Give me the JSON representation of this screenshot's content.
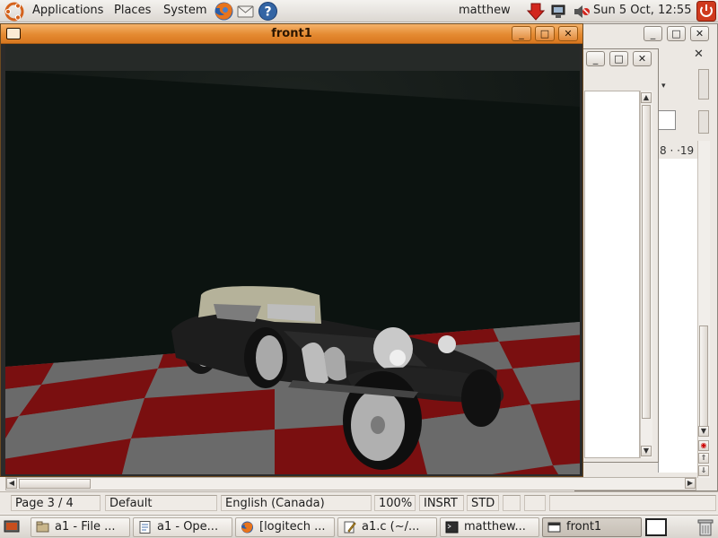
{
  "top_panel": {
    "menus": [
      "Applications",
      "Places",
      "System"
    ],
    "user": "matthew",
    "clock": "Sun  5 Oct, 12:55"
  },
  "window": {
    "title": "front1",
    "buttons": {
      "minimize": "_",
      "maximize": "□",
      "close": "✕"
    }
  },
  "background_window": {
    "ruler_text": "8 · ·19",
    "close_glyph": "✕",
    "more_glyph": "»"
  },
  "writer_status": {
    "page": "Page 3 / 4",
    "style": "Default",
    "language": "English (Canada)",
    "zoom": "100%",
    "insert_mode": "INSRT",
    "selection_mode": "STD"
  },
  "taskbar": {
    "tasks": [
      {
        "label": "a1 - File ...",
        "icon": "folder-icon"
      },
      {
        "label": "a1 - Ope...",
        "icon": "document-icon"
      },
      {
        "label": "[logitech ...",
        "icon": "firefox-icon"
      },
      {
        "label": "a1.c (~/...",
        "icon": "text-editor-icon"
      },
      {
        "label": "matthew...",
        "icon": "terminal-icon"
      },
      {
        "label": "front1",
        "icon": "window-icon"
      }
    ]
  },
  "colors": {
    "title_bar": "#e48a31",
    "checker_red": "#7a0f10",
    "checker_grey": "#666666",
    "scene_background": "#0d1411"
  }
}
